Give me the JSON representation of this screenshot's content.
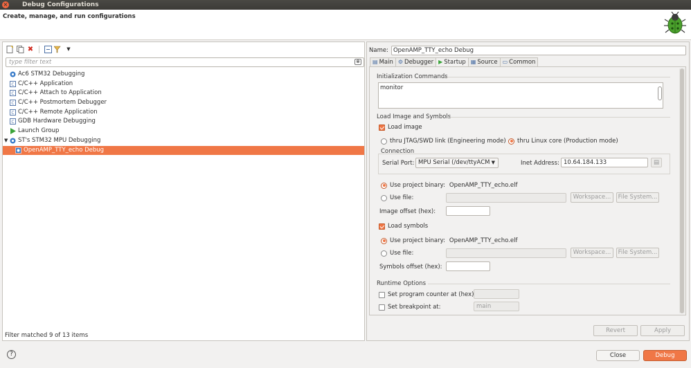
{
  "window": {
    "title": "Debug Configurations",
    "close_glyph": "×"
  },
  "header": {
    "subtitle": "Create, manage, and run configurations",
    "icon": "bug-icon"
  },
  "left": {
    "filter_placeholder": "type filter text",
    "tree": [
      {
        "label": "Ac6 STM32 Debugging",
        "icon": "ac6-icon",
        "color": "#3a7cc9",
        "level": 0,
        "selected": false
      },
      {
        "label": "C/C++ Application",
        "icon": "c-app-icon",
        "color": "#5577aa",
        "level": 0,
        "selected": false
      },
      {
        "label": "C/C++ Attach to Application",
        "icon": "c-attach-icon",
        "color": "#5577aa",
        "level": 0,
        "selected": false
      },
      {
        "label": "C/C++ Postmortem Debugger",
        "icon": "c-postmortem-icon",
        "color": "#5577aa",
        "level": 0,
        "selected": false
      },
      {
        "label": "C/C++ Remote Application",
        "icon": "c-remote-icon",
        "color": "#5577aa",
        "level": 0,
        "selected": false
      },
      {
        "label": "GDB Hardware Debugging",
        "icon": "gdb-icon",
        "color": "#5577aa",
        "level": 0,
        "selected": false
      },
      {
        "label": "Launch Group",
        "icon": "launch-group-icon",
        "color": "#3aa43a",
        "level": 0,
        "selected": false
      },
      {
        "label": "ST's STM32 MPU Debugging",
        "icon": "st-mpu-icon",
        "color": "#3a7cc9",
        "level": 0,
        "selected": false,
        "expanded": true
      },
      {
        "label": "OpenAMP_TTY_echo Debug",
        "icon": "debug-config-icon",
        "color": "#ffffff",
        "level": 1,
        "selected": true
      }
    ],
    "status": "Filter matched 9 of 13 items"
  },
  "right": {
    "name_label": "Name:",
    "name_value": "OpenAMP_TTY_echo Debug",
    "tabs": [
      {
        "label": "Main",
        "icon": "main-tab-icon",
        "active": false
      },
      {
        "label": "Debugger",
        "icon": "debugger-tab-icon",
        "active": false
      },
      {
        "label": "Startup",
        "icon": "startup-tab-icon",
        "active": true
      },
      {
        "label": "Source",
        "icon": "source-tab-icon",
        "active": false
      },
      {
        "label": "Common",
        "icon": "common-tab-icon",
        "active": false
      }
    ],
    "startup": {
      "init_title": "Initialization Commands",
      "init_text": "monitor",
      "load_title": "Load Image and Symbols",
      "load_image": "Load image",
      "jtag_option": "thru JTAG/SWD link (Engineering mode)",
      "linux_option": "thru Linux core (Production mode)",
      "connection_title": "Connection",
      "serial_port_label": "Serial Port:",
      "serial_port_value": "MPU Serial (/dev/ttyACM",
      "inet_label": "Inet Address:",
      "inet_value": "10.64.184.133",
      "use_project_binary": "Use project binary:",
      "project_binary_value": "OpenAMP_TTY_echo.elf",
      "use_file": "Use file:",
      "workspace_btn": "Workspace...",
      "filesystem_btn": "File System...",
      "image_offset": "Image offset (hex):",
      "load_symbols": "Load symbols",
      "symbols_offset": "Symbols offset (hex):",
      "runtime_title": "Runtime Options",
      "set_pc": "Set program counter at (hex):",
      "set_bp": "Set breakpoint at:",
      "bp_value": "main"
    },
    "revert": "Revert",
    "apply": "Apply"
  },
  "footer": {
    "help": "?",
    "close": "Close",
    "debug": "Debug",
    "accent": "#f07746"
  }
}
